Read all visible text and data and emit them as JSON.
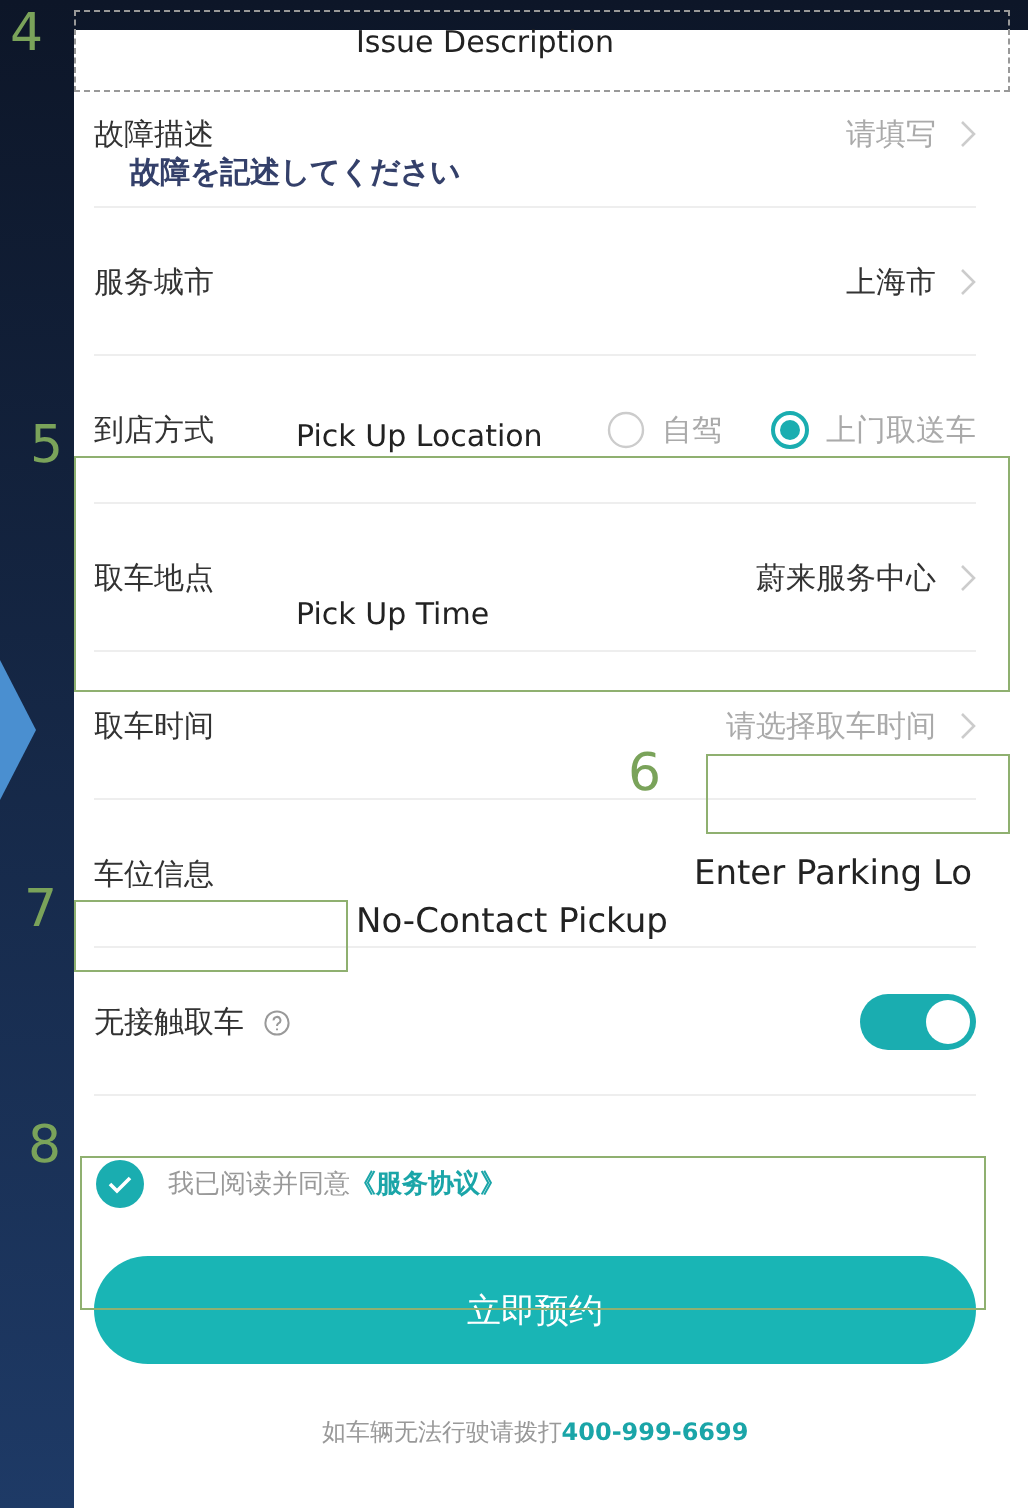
{
  "form": {
    "rows": [
      {
        "kind": "link",
        "label": "故障描述",
        "value": "请填写",
        "empty": true
      },
      {
        "kind": "link",
        "label": "服务城市",
        "value": "上海市",
        "empty": false
      },
      {
        "kind": "radio",
        "label": "到店方式",
        "options": [
          {
            "label": "自驾",
            "selected": false
          },
          {
            "label": "上门取送车",
            "selected": true
          }
        ]
      },
      {
        "kind": "link",
        "label": "取车地点",
        "value": "蔚来服务中心",
        "empty": false
      },
      {
        "kind": "link",
        "label": "取车时间",
        "value": "请选择取车时间",
        "empty": true
      },
      {
        "kind": "text",
        "label": "车位信息"
      },
      {
        "kind": "toggle",
        "label": "无接触取车",
        "help": true,
        "on": true
      }
    ]
  },
  "agreement": {
    "checked": true,
    "text": "我已阅读并同意",
    "link": "《服务协议》"
  },
  "submit_button": "立即预约",
  "footer": {
    "text": "如车辆无法行驶请拨打",
    "phone": "400-999-6699"
  },
  "annotations": [
    {
      "number": "4",
      "captions": [
        "Issue Description",
        "故障を記述してください"
      ]
    },
    {
      "number": "5",
      "captions": [
        "Pick Up Location",
        "Pick Up Time"
      ]
    },
    {
      "number": "6",
      "captions": [
        "Enter Parking Lo"
      ]
    },
    {
      "number": "7",
      "captions": [
        "No-Contact Pickup"
      ]
    },
    {
      "number": "8"
    }
  ]
}
